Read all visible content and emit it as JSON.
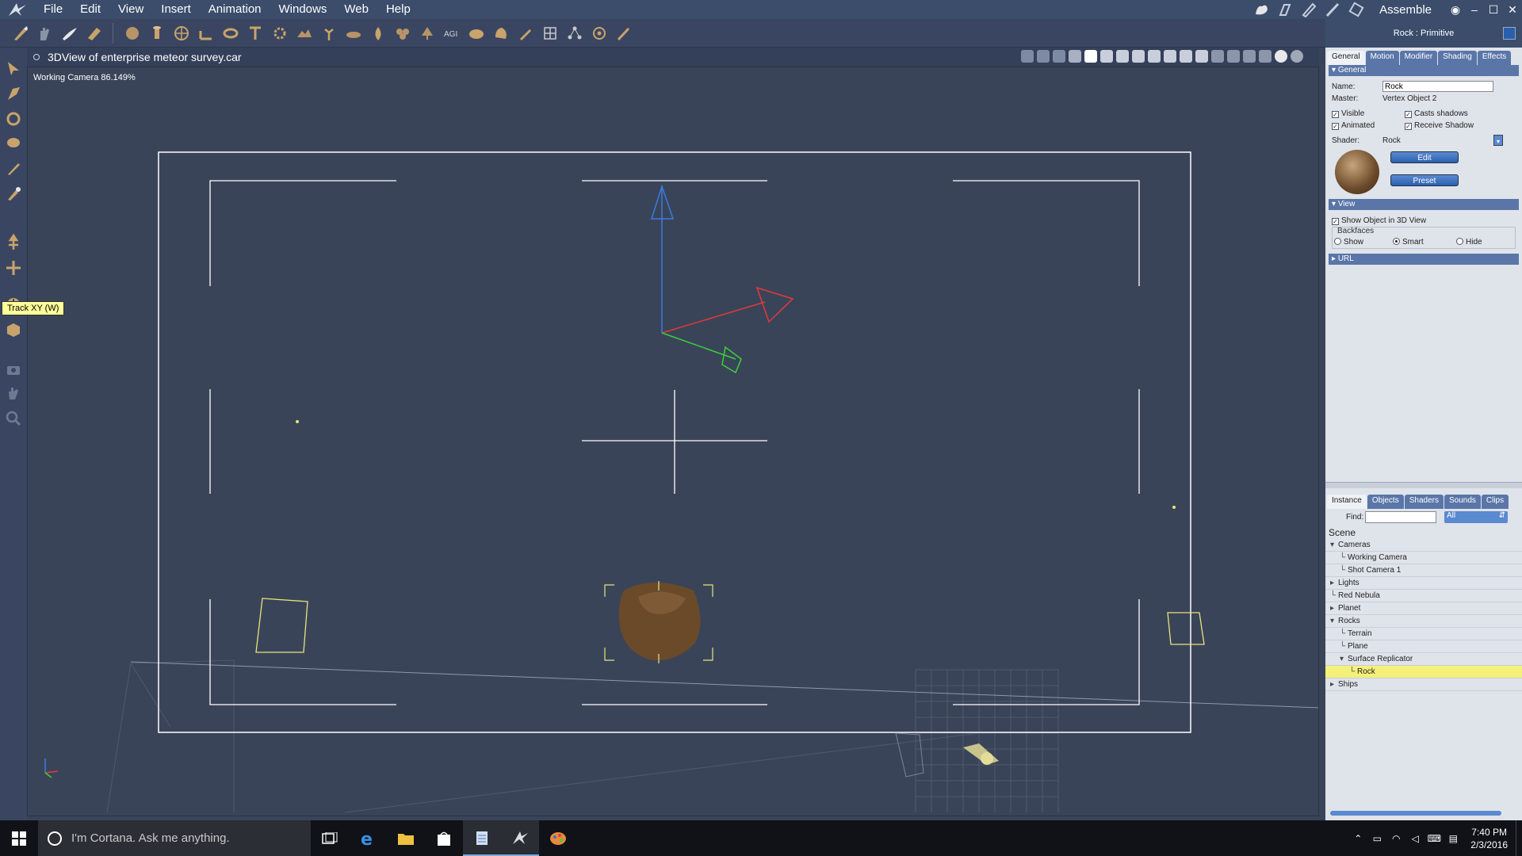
{
  "menubar": {
    "items": [
      "File",
      "Edit",
      "View",
      "Insert",
      "Animation",
      "Windows",
      "Web",
      "Help"
    ],
    "room": "Assemble"
  },
  "toolbar": {
    "icons": [
      "brush-icon",
      "hand-icon",
      "paint-icon",
      "sculpt-icon",
      "sphere-icon",
      "cylinder-icon",
      "globe-icon",
      "figure-icon",
      "torus-icon",
      "text-icon",
      "gear-icon",
      "terrain-icon",
      "plant-icon",
      "cloud-icon",
      "hand-icon",
      "star-icon",
      "tree-icon",
      "agi-icon",
      "rock-icon",
      "stone-icon",
      "pen-icon",
      "lattice-icon",
      "cluster-icon",
      "target-icon",
      "wand-icon"
    ]
  },
  "view": {
    "title": "3DView of enterprise meteor survey.car",
    "camera_label": "Working Camera 86.149%"
  },
  "tooltip": "Track XY (W)",
  "panel": {
    "title": "Rock : Primitive",
    "tabs": [
      "General",
      "Motion",
      "Modifier",
      "Shading",
      "Effects"
    ],
    "general_section": "General",
    "name_label": "Name:",
    "name_value": "Rock",
    "master_label": "Master:",
    "master_value": "Vertex Object 2",
    "visible": "Visible",
    "casts_shadows": "Casts shadows",
    "animated": "Animated",
    "receive_shadow": "Receive Shadow",
    "shader_label": "Shader:",
    "shader_value": "Rock",
    "edit_button": "Edit",
    "preset_button": "Preset",
    "view_section": "View",
    "show_object": "Show Object in 3D View",
    "backfaces": "Backfaces",
    "bf_show": "Show",
    "bf_smart": "Smart",
    "bf_hide": "Hide",
    "url_section": "URL"
  },
  "browser": {
    "tabs": [
      "Instance",
      "Objects",
      "Shaders",
      "Sounds",
      "Clips"
    ],
    "find_label": "Find:",
    "filter": "All",
    "scene_label": "Scene",
    "tree": [
      {
        "label": "Cameras",
        "indent": 1,
        "expander": "open"
      },
      {
        "label": "Working Camera",
        "indent": 2,
        "expander": "none"
      },
      {
        "label": "Shot Camera 1",
        "indent": 2,
        "expander": "none"
      },
      {
        "label": "Lights",
        "indent": 1,
        "expander": "closed"
      },
      {
        "label": "Red Nebula",
        "indent": 1,
        "expander": "none"
      },
      {
        "label": "Planet",
        "indent": 1,
        "expander": "closed"
      },
      {
        "label": "Rocks",
        "indent": 1,
        "expander": "open"
      },
      {
        "label": "Terrain",
        "indent": 2,
        "expander": "none"
      },
      {
        "label": "Plane",
        "indent": 2,
        "expander": "none"
      },
      {
        "label": "Surface Replicator",
        "indent": 2,
        "expander": "open"
      },
      {
        "label": "Rock",
        "indent": 3,
        "expander": "none",
        "selected": true
      },
      {
        "label": "Ships",
        "indent": 1,
        "expander": "closed"
      }
    ]
  },
  "taskbar": {
    "search_placeholder": "I'm Cortana. Ask me anything.",
    "time": "7:40 PM",
    "date": "2/3/2016"
  },
  "colors": {
    "viewport_bg": "#3a4459",
    "accent": "#5a76a8",
    "selection": "#f4f07a"
  }
}
